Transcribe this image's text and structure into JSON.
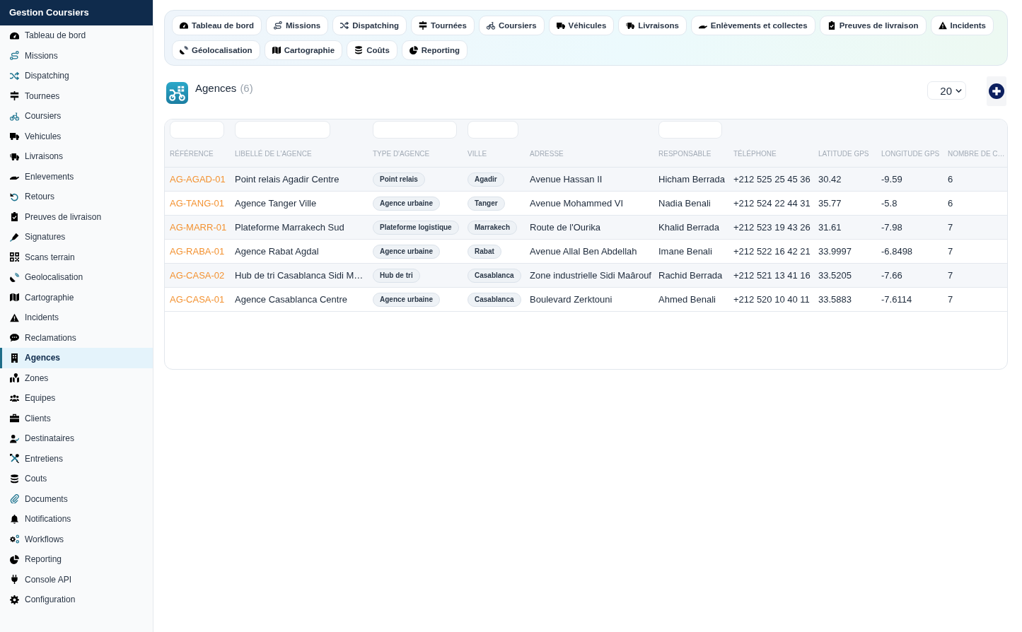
{
  "sidebar": {
    "title": "Gestion Coursiers",
    "items": [
      {
        "label": "Tableau de bord",
        "selected": false
      },
      {
        "label": "Missions",
        "selected": false
      },
      {
        "label": "Dispatching",
        "selected": false
      },
      {
        "label": "Tournees",
        "selected": false
      },
      {
        "label": "Coursiers",
        "selected": false
      },
      {
        "label": "Vehicules",
        "selected": false
      },
      {
        "label": "Livraisons",
        "selected": false
      },
      {
        "label": "Enlevements",
        "selected": false
      },
      {
        "label": "Retours",
        "selected": false
      },
      {
        "label": "Preuves de livraison",
        "selected": false
      },
      {
        "label": "Signatures",
        "selected": false
      },
      {
        "label": "Scans terrain",
        "selected": false
      },
      {
        "label": "Geolocalisation",
        "selected": false
      },
      {
        "label": "Cartographie",
        "selected": false
      },
      {
        "label": "Incidents",
        "selected": false
      },
      {
        "label": "Reclamations",
        "selected": false
      },
      {
        "label": "Agences",
        "selected": true
      },
      {
        "label": "Zones",
        "selected": false
      },
      {
        "label": "Equipes",
        "selected": false
      },
      {
        "label": "Clients",
        "selected": false
      },
      {
        "label": "Destinataires",
        "selected": false
      },
      {
        "label": "Entretiens",
        "selected": false
      },
      {
        "label": "Couts",
        "selected": false
      },
      {
        "label": "Documents",
        "selected": false
      },
      {
        "label": "Notifications",
        "selected": false
      },
      {
        "label": "Workflows",
        "selected": false
      },
      {
        "label": "Reporting",
        "selected": false
      },
      {
        "label": "Console API",
        "selected": false
      },
      {
        "label": "Configuration",
        "selected": false
      }
    ]
  },
  "nav": {
    "links": [
      "Tableau de bord",
      "Missions",
      "Dispatching",
      "Tournées",
      "Coursiers",
      "Véhicules",
      "Livraisons",
      "Enlèvements et collectes",
      "Preuves de livraison",
      "Incidents",
      "Géolocalisation",
      "Cartographie",
      "Coûts",
      "Reporting"
    ]
  },
  "header": {
    "title": "Agences",
    "count": "(6)",
    "page_size": "20"
  },
  "table": {
    "columns": [
      {
        "label": "RÉFÉRENCE",
        "kind": "link",
        "filter": true
      },
      {
        "label": "LIBELLÉ DE L'AGENCE",
        "kind": "text",
        "filter": true
      },
      {
        "label": "TYPE D'AGENCE",
        "kind": "tag",
        "filter": true
      },
      {
        "label": "VILLE",
        "kind": "tag",
        "filter": true
      },
      {
        "label": "ADRESSE",
        "kind": "text",
        "filter": false
      },
      {
        "label": "RESPONSABLE",
        "kind": "text",
        "filter": true
      },
      {
        "label": "TÉLÉPHONE",
        "kind": "text",
        "filter": false
      },
      {
        "label": "LATITUDE GPS",
        "kind": "text",
        "filter": false
      },
      {
        "label": "LONGITUDE GPS",
        "kind": "text",
        "filter": false
      },
      {
        "label": "NOMBRE DE C…",
        "kind": "text",
        "filter": false
      }
    ],
    "rows": [
      {
        "cells": [
          "AG-AGAD-01",
          "Point relais Agadir Centre",
          "Point relais",
          "Agadir",
          "Avenue Hassan II",
          "Hicham Berrada",
          "+212 525 25 45 36",
          "30.42",
          "-9.59",
          "6"
        ]
      },
      {
        "cells": [
          "AG-TANG-01",
          "Agence Tanger Ville",
          "Agence urbaine",
          "Tanger",
          "Avenue Mohammed VI",
          "Nadia Benali",
          "+212 524 22 44 31",
          "35.77",
          "-5.8",
          "6"
        ]
      },
      {
        "cells": [
          "AG-MARR-01",
          "Plateforme Marrakech Sud",
          "Plateforme logistique",
          "Marrakech",
          "Route de l'Ourika",
          "Khalid Berrada",
          "+212 523 19 43 26",
          "31.61",
          "-7.98",
          "7"
        ]
      },
      {
        "cells": [
          "AG-RABA-01",
          "Agence Rabat Agdal",
          "Agence urbaine",
          "Rabat",
          "Avenue Allal Ben Abdellah",
          "Imane Benali",
          "+212 522 16 42 21",
          "33.9997",
          "-6.8498",
          "7"
        ]
      },
      {
        "cells": [
          "AG-CASA-02",
          "Hub de tri Casablanca Sidi M…",
          "Hub de tri",
          "Casablanca",
          "Zone industrielle Sidi Maârouf",
          "Rachid Berrada",
          "+212 521 13 41 16",
          "33.5205",
          "-7.66",
          "7"
        ]
      },
      {
        "cells": [
          "AG-CASA-01",
          "Agence Casablanca Centre",
          "Agence urbaine",
          "Casablanca",
          "Boulevard Zerktouni",
          "Ahmed Benali",
          "+212 520 10 40 11",
          "33.5883",
          "-7.6114",
          "7"
        ]
      }
    ]
  }
}
